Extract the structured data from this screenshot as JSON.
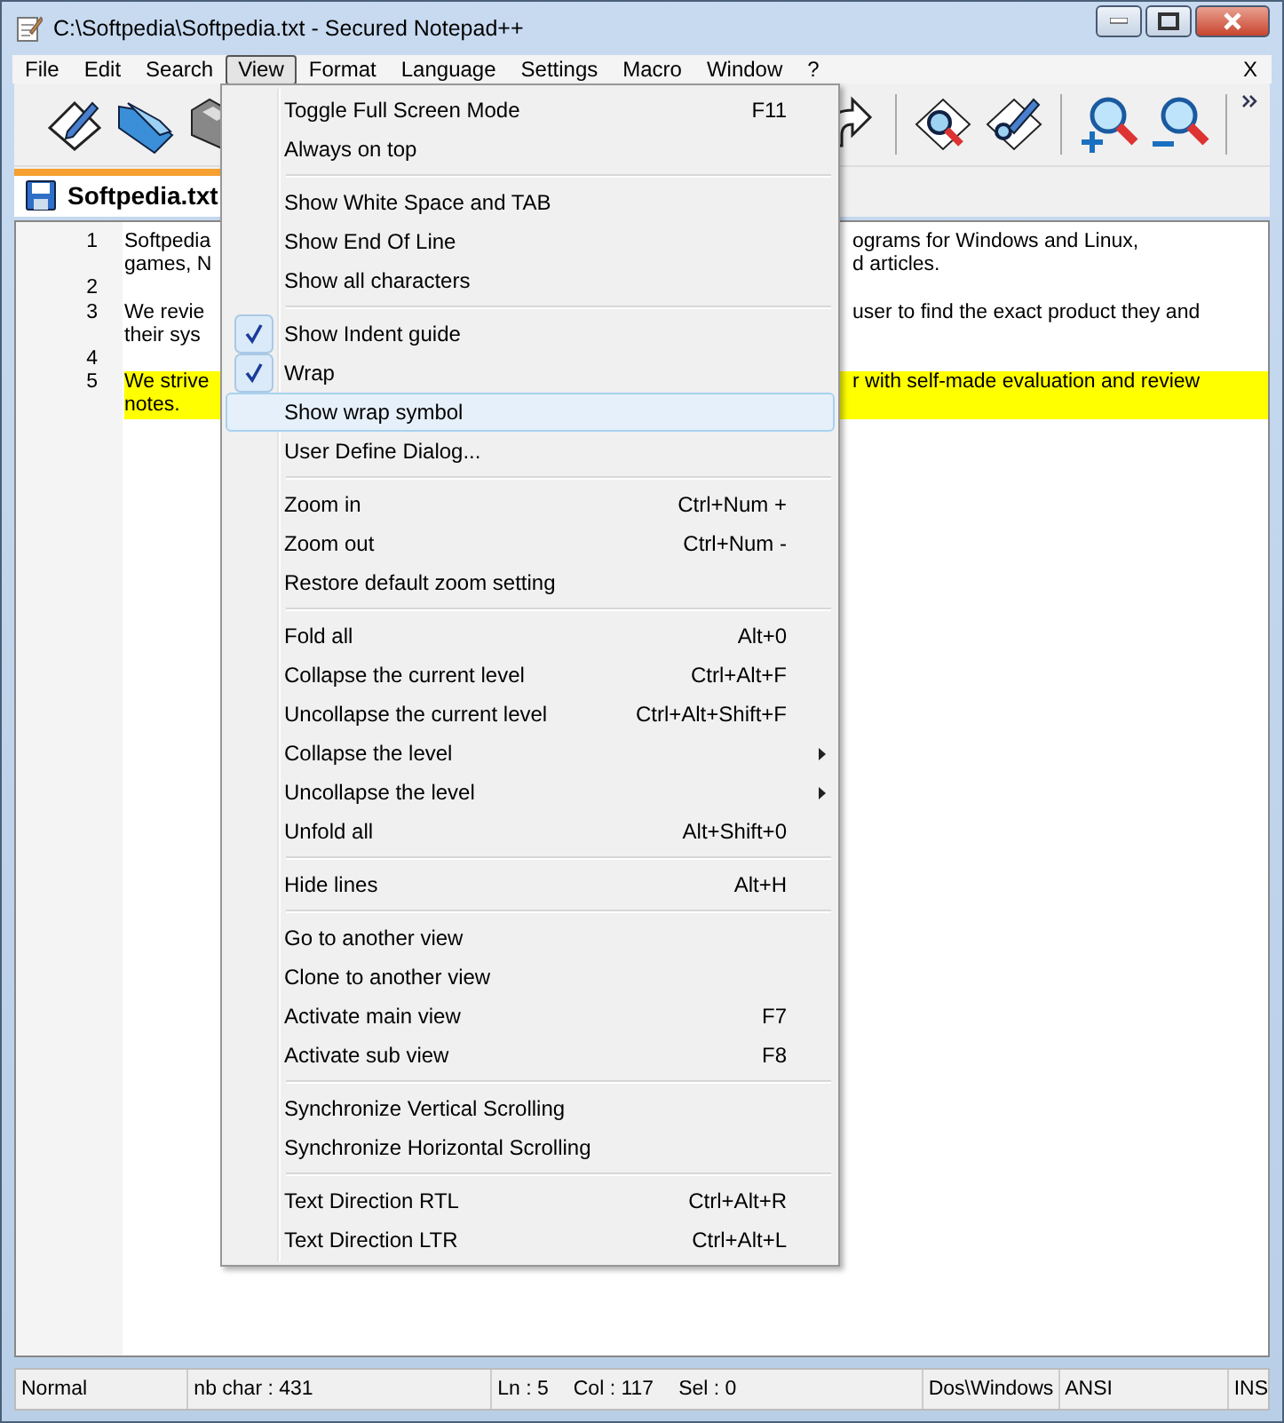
{
  "window": {
    "title": "C:\\Softpedia\\Softpedia.txt - Secured Notepad++"
  },
  "menu_bar": {
    "items": [
      {
        "label": "File",
        "selected": false
      },
      {
        "label": "Edit",
        "selected": false
      },
      {
        "label": "Search",
        "selected": false
      },
      {
        "label": "View",
        "selected": true
      },
      {
        "label": "Format",
        "selected": false
      },
      {
        "label": "Language",
        "selected": false
      },
      {
        "label": "Settings",
        "selected": false
      },
      {
        "label": "Macro",
        "selected": false
      },
      {
        "label": "Window",
        "selected": false
      },
      {
        "label": "?",
        "selected": false
      }
    ],
    "close_label": "X"
  },
  "tab": {
    "label": "Softpedia.txt"
  },
  "editor": {
    "lines": [
      {
        "number": "1",
        "highlighted": false,
        "rows": [
          {
            "left": "Softpedia",
            "right": "ograms for Windows and Linux,"
          },
          {
            "left": "games, N",
            "right": "d articles."
          }
        ]
      },
      {
        "number": "2",
        "highlighted": false
      },
      {
        "number": "3",
        "highlighted": false,
        "rows": [
          {
            "left": "We revie",
            "right": "user to find the exact product they and"
          },
          {
            "left": "their sys"
          }
        ]
      },
      {
        "number": "4",
        "highlighted": false
      },
      {
        "number": "5",
        "highlighted": true,
        "rows": [
          {
            "left": "We strive",
            "right": "r with self-made evaluation and review"
          },
          {
            "left": "notes."
          }
        ]
      }
    ]
  },
  "view_menu": {
    "groups": [
      [
        {
          "kind": "item",
          "label": "Toggle Full Screen Mode",
          "shortcut": "F11",
          "checked": false,
          "selected": false
        },
        {
          "kind": "item",
          "label": "Always on top",
          "checked": false,
          "selected": false
        }
      ],
      [
        {
          "kind": "item",
          "label": "Show White Space and TAB",
          "checked": false,
          "selected": false
        },
        {
          "kind": "item",
          "label": "Show End Of Line",
          "checked": false,
          "selected": false
        },
        {
          "kind": "item",
          "label": "Show all characters",
          "checked": false,
          "selected": false
        }
      ],
      [
        {
          "kind": "item",
          "label": "Show Indent guide",
          "checked": true,
          "selected": false
        },
        {
          "kind": "item",
          "label": "Wrap",
          "checked": true,
          "selected": false
        },
        {
          "kind": "item",
          "label": "Show wrap symbol",
          "checked": false,
          "selected": true
        },
        {
          "kind": "item",
          "label": "User Define Dialog...",
          "checked": false,
          "selected": false
        }
      ],
      [
        {
          "kind": "item",
          "label": "Zoom in",
          "shortcut": "Ctrl+Num +",
          "checked": false,
          "selected": false
        },
        {
          "kind": "item",
          "label": "Zoom out",
          "shortcut": "Ctrl+Num -",
          "checked": false,
          "selected": false
        },
        {
          "kind": "item",
          "label": "Restore default zoom setting",
          "checked": false,
          "selected": false
        }
      ],
      [
        {
          "kind": "item",
          "label": "Fold all",
          "shortcut": "Alt+0",
          "checked": false,
          "selected": false
        },
        {
          "kind": "item",
          "label": "Collapse the current level",
          "shortcut": "Ctrl+Alt+F",
          "checked": false,
          "selected": false
        },
        {
          "kind": "item",
          "label": "Uncollapse the current level",
          "shortcut": "Ctrl+Alt+Shift+F",
          "checked": false,
          "selected": false
        },
        {
          "kind": "submenu",
          "label": "Collapse the level",
          "checked": false,
          "selected": false
        },
        {
          "kind": "submenu",
          "label": "Uncollapse the level",
          "checked": false,
          "selected": false
        },
        {
          "kind": "item",
          "label": "Unfold all",
          "shortcut": "Alt+Shift+0",
          "checked": false,
          "selected": false
        }
      ],
      [
        {
          "kind": "item",
          "label": "Hide lines",
          "shortcut": "Alt+H",
          "checked": false,
          "selected": false
        }
      ],
      [
        {
          "kind": "item",
          "label": "Go to another view",
          "checked": false,
          "selected": false
        },
        {
          "kind": "item",
          "label": "Clone to another view",
          "checked": false,
          "selected": false
        },
        {
          "kind": "item",
          "label": "Activate main view",
          "shortcut": "F7",
          "checked": false,
          "selected": false
        },
        {
          "kind": "item",
          "label": "Activate sub view",
          "shortcut": "F8",
          "checked": false,
          "selected": false
        }
      ],
      [
        {
          "kind": "item",
          "label": "Synchronize Vertical Scrolling",
          "checked": false,
          "selected": false
        },
        {
          "kind": "item",
          "label": "Synchronize Horizontal Scrolling",
          "checked": false,
          "selected": false
        }
      ],
      [
        {
          "kind": "item",
          "label": "Text Direction RTL",
          "shortcut": "Ctrl+Alt+R",
          "checked": false,
          "selected": false
        },
        {
          "kind": "item",
          "label": "Text Direction LTR",
          "shortcut": "Ctrl+Alt+L",
          "checked": false,
          "selected": false
        }
      ]
    ]
  },
  "status_bar": {
    "mode": "Normal",
    "chars": "nb char : 431",
    "line": "Ln : 5",
    "column": "Col : 117",
    "selection": "Sel : 0",
    "eol": "Dos\\Windows",
    "encoding": "ANSI",
    "insert": "INS"
  }
}
